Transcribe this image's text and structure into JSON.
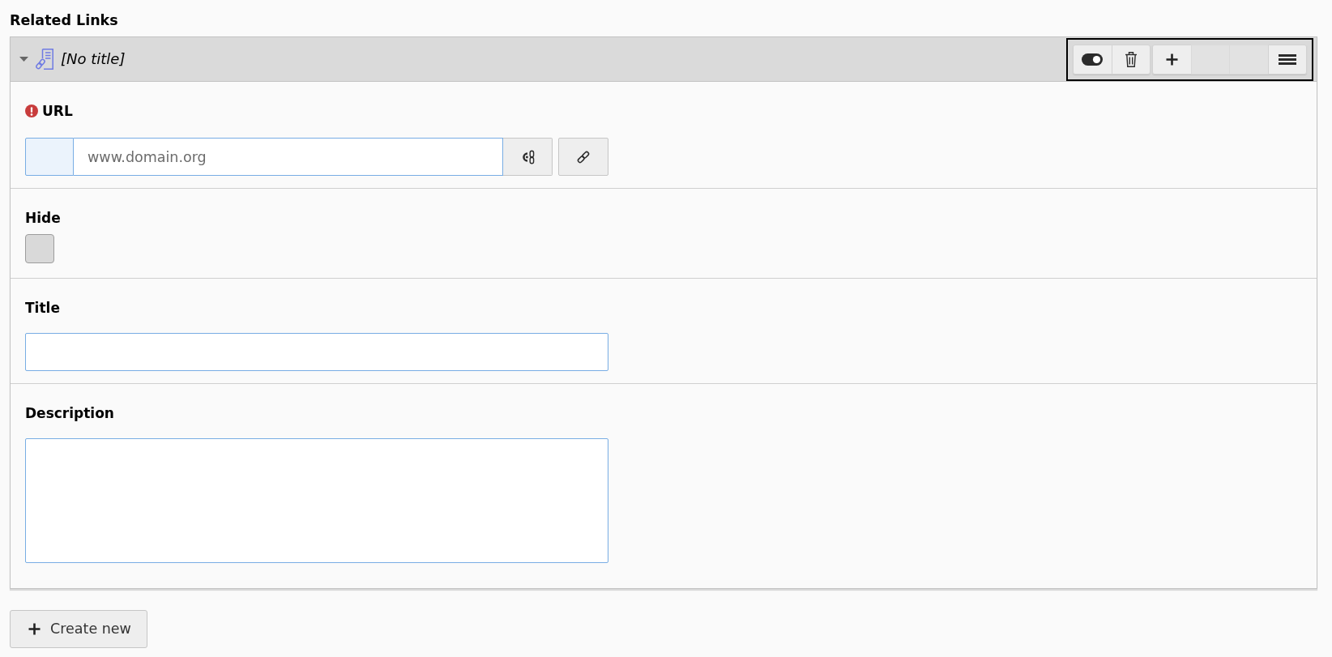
{
  "section_title": "Related Links",
  "record": {
    "expanded": true,
    "title": "[No title]",
    "toolbar": {
      "focused": true,
      "groups": [
        {
          "buttons": [
            {
              "kind": "toggle"
            },
            {
              "kind": "delete"
            }
          ]
        },
        {
          "buttons": [
            {
              "kind": "add"
            },
            {
              "kind": "blank"
            },
            {
              "kind": "blank"
            },
            {
              "kind": "menu"
            }
          ]
        }
      ]
    },
    "fields": [
      {
        "kind": "link",
        "label": "URL",
        "error": true,
        "placeholder": "www.domain.org"
      },
      {
        "kind": "checkbox",
        "label": "Hide",
        "error": false,
        "checked": false
      },
      {
        "kind": "text",
        "label": "Title",
        "error": false
      },
      {
        "kind": "textarea",
        "label": "Description",
        "error": false
      }
    ]
  },
  "create_button": {
    "label": "Create new"
  }
}
